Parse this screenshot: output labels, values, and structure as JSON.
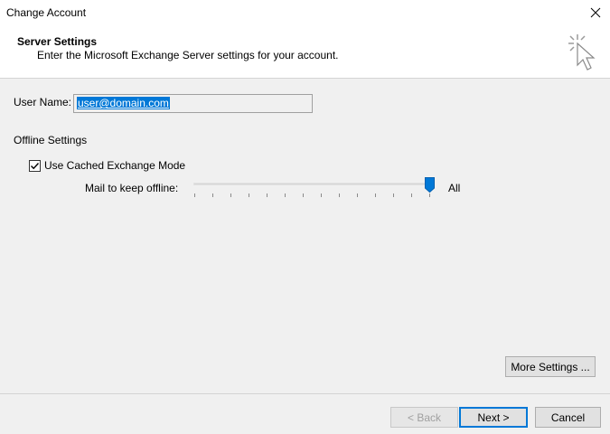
{
  "window": {
    "title": "Change Account",
    "close_icon": "close-icon"
  },
  "header": {
    "title": "Server Settings",
    "subtitle": "Enter the Microsoft Exchange Server settings for your account.",
    "icon": "cursor-click-icon"
  },
  "user": {
    "label": "User Name:",
    "value": "user@domain.com"
  },
  "offline": {
    "section_label": "Offline Settings",
    "cached_mode_label": "Use Cached Exchange Mode",
    "cached_mode_checked": true,
    "mail_label": "Mail to keep offline:",
    "slider_value_label": "All",
    "slider_position": 1.0
  },
  "buttons": {
    "more_settings": "More Settings ...",
    "back": "< Back",
    "next": "Next >",
    "cancel": "Cancel"
  },
  "colors": {
    "accent": "#0078d7",
    "selection": "#0078d7",
    "background": "#f0f0f0"
  }
}
